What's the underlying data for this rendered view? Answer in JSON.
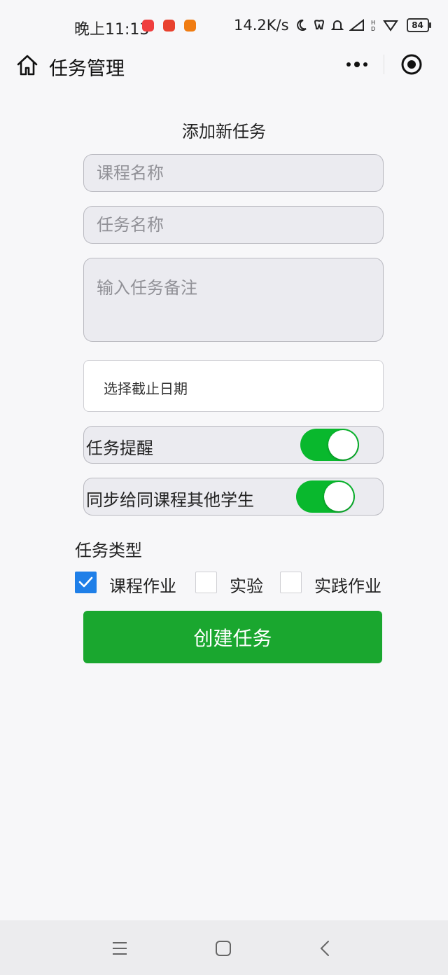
{
  "status_bar": {
    "time": "晚上11:13",
    "network_speed": "14.2K/s",
    "battery": "84",
    "app_icon_colors": [
      "#ef3e3e",
      "#e8412e",
      "#f07c12"
    ]
  },
  "nav": {
    "title": "任务管理"
  },
  "form": {
    "title": "添加新任务",
    "course_name_placeholder": "课程名称",
    "task_name_placeholder": "任务名称",
    "note_placeholder": "输入任务备注",
    "date_picker_label": "选择截止日期",
    "reminder_label": "任务提醒",
    "reminder_on": true,
    "sync_label": "同步给同课程其他学生",
    "sync_on": true,
    "type_label": "任务类型",
    "types": [
      {
        "label": "课程作业",
        "checked": true
      },
      {
        "label": "实验",
        "checked": false
      },
      {
        "label": "实践作业",
        "checked": false
      }
    ],
    "submit_label": "创建任务"
  },
  "colors": {
    "accent_green": "#1aa72f",
    "toggle_green": "#09b82d",
    "checkbox_blue": "#1f7fe8"
  }
}
